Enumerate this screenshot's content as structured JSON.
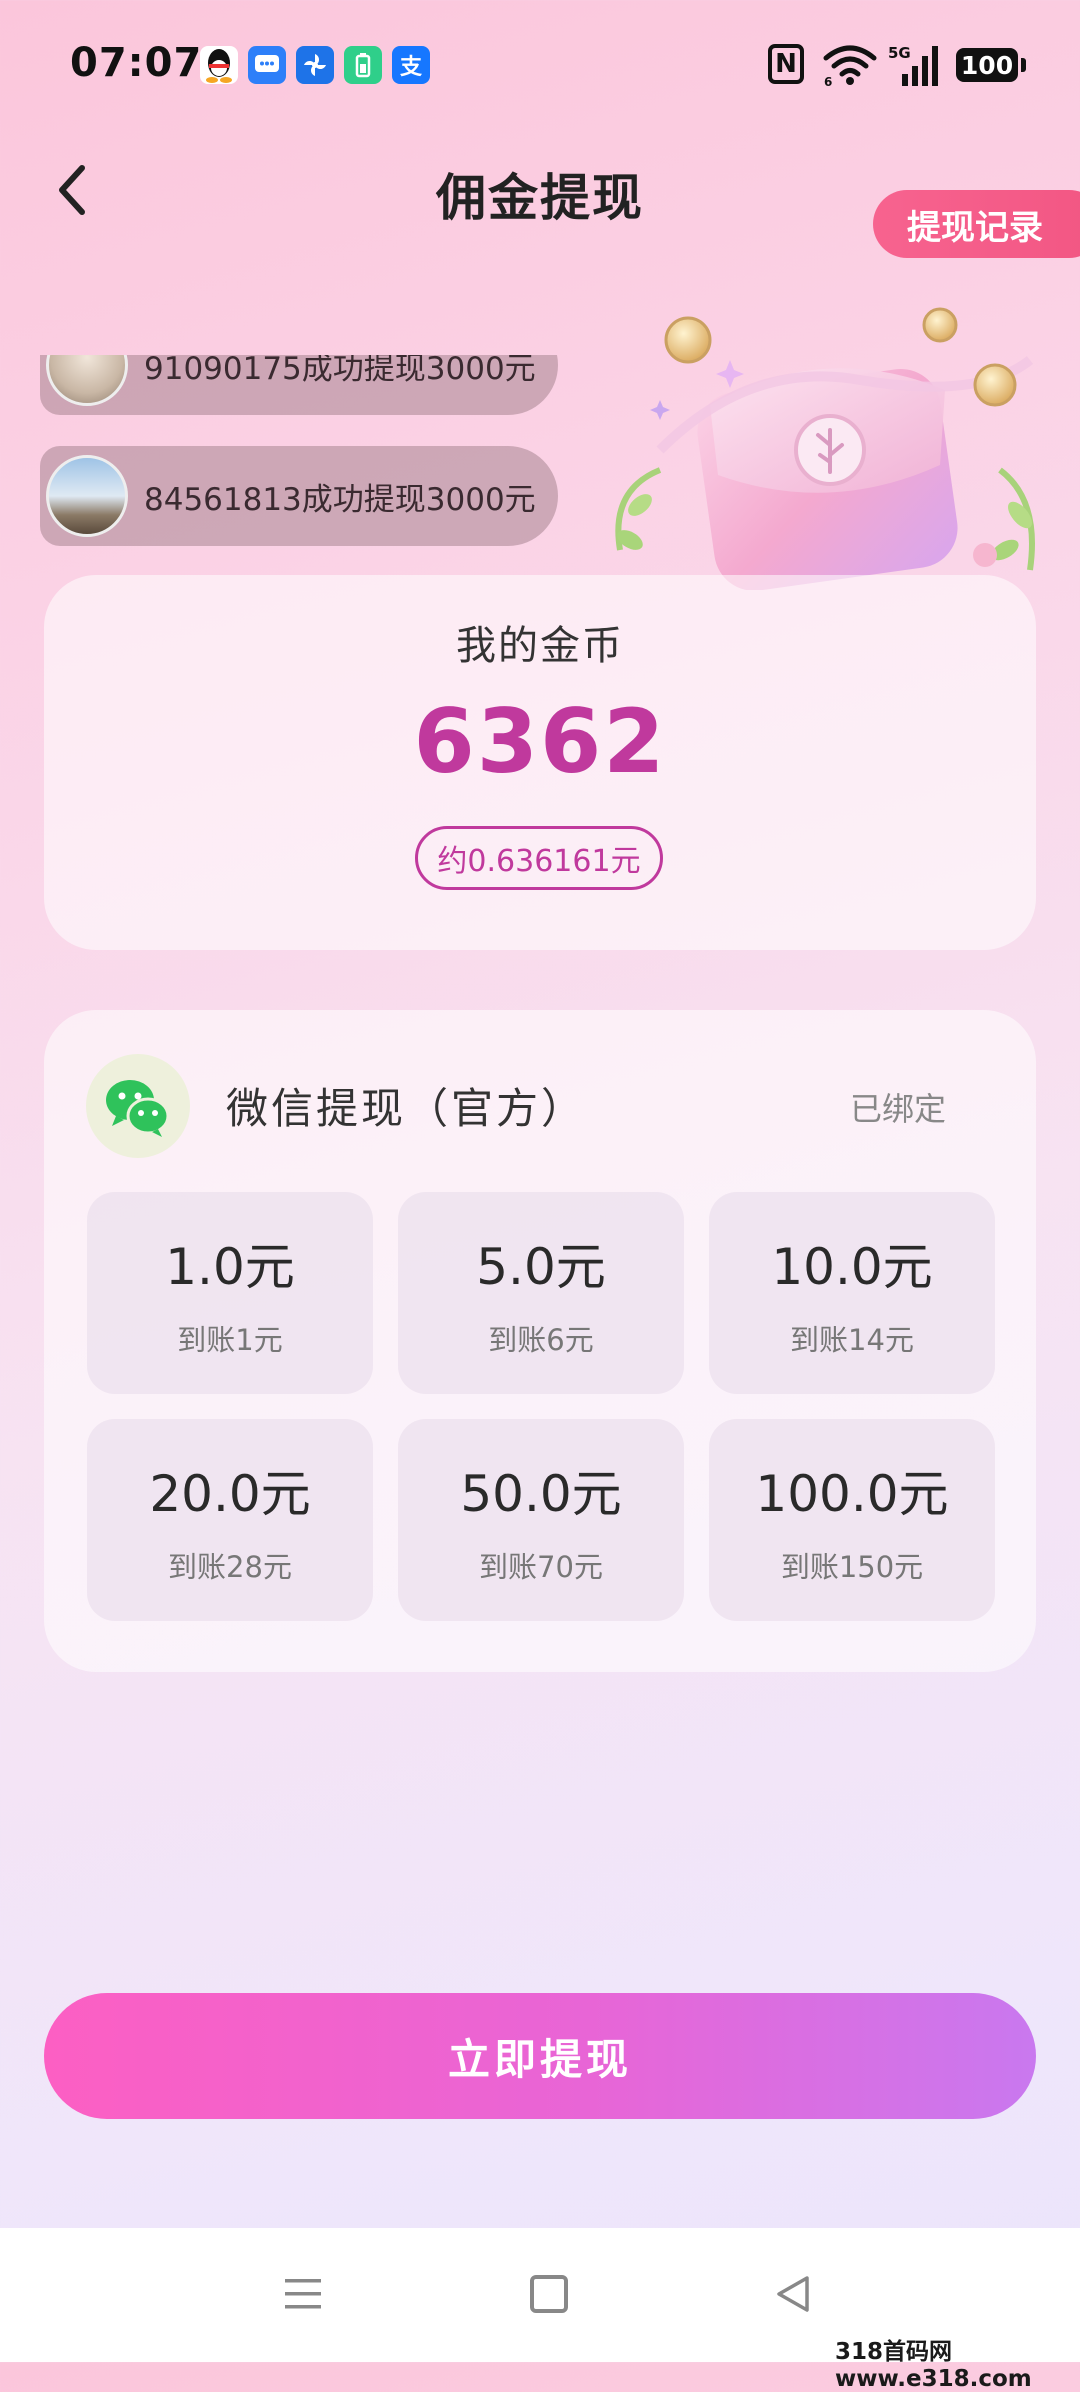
{
  "status_bar": {
    "time": "07:07",
    "battery": "100",
    "network": "5G",
    "notification_icons": [
      "qq-icon",
      "messages-icon",
      "fan-app-icon",
      "battery-app-icon",
      "alipay-icon"
    ],
    "alipay_glyph": "支"
  },
  "header": {
    "title": "佣金提现",
    "record_button": "提现记录"
  },
  "notices": [
    {
      "text": "91090175成功提现3000元"
    },
    {
      "text": "84561813成功提现3000元"
    }
  ],
  "coins": {
    "label": "我的金币",
    "value": "6362",
    "approx": "约0.636161元"
  },
  "withdraw": {
    "method_label": "微信提现（官方）",
    "bound_status": "已绑定",
    "options": [
      {
        "amount": "1.0元",
        "arrival": "到账1元"
      },
      {
        "amount": "5.0元",
        "arrival": "到账6元"
      },
      {
        "amount": "10.0元",
        "arrival": "到账14元"
      },
      {
        "amount": "20.0元",
        "arrival": "到账28元"
      },
      {
        "amount": "50.0元",
        "arrival": "到账70元"
      },
      {
        "amount": "100.0元",
        "arrival": "到账150元"
      }
    ]
  },
  "submit_button": "立即提现",
  "watermark": "318首码网 www.e318.com",
  "colors": {
    "accent": "#c0399d",
    "record_button": "#f25683",
    "submit_start": "#fc5fc3",
    "submit_end": "#c978ef",
    "wechat_green": "#2fc25b"
  }
}
